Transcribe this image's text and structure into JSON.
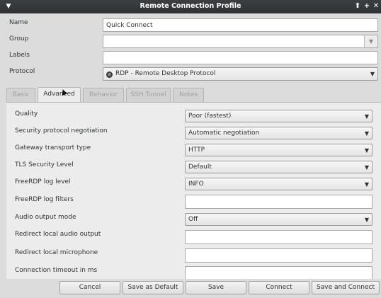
{
  "window": {
    "title": "Remote Connection Profile"
  },
  "titlebar_icons": [
    "menu-icon",
    "shade-up-icon",
    "maximize-icon",
    "close-icon"
  ],
  "form": {
    "name_label": "Name",
    "name_value": "Quick Connect",
    "group_label": "Group",
    "group_value": "",
    "labels_label": "Labels",
    "labels_value": "",
    "protocol_label": "Protocol",
    "protocol_value": "RDP - Remote Desktop Protocol"
  },
  "tabs": [
    {
      "label": "Basic",
      "active": false
    },
    {
      "label": "Advanced",
      "active": true
    },
    {
      "label": "Behavior",
      "active": false
    },
    {
      "label": "SSH Tunnel",
      "active": false
    },
    {
      "label": "Notes",
      "active": false
    }
  ],
  "advanced": {
    "quality_label": "Quality",
    "quality_value": "Poor (fastest)",
    "security_label": "Security protocol negotiation",
    "security_value": "Automatic negotiation",
    "gateway_label": "Gateway transport type",
    "gateway_value": "HTTP",
    "tls_label": "TLS Security Level",
    "tls_value": "Default",
    "loglevel_label": "FreeRDP log level",
    "loglevel_value": "INFO",
    "logfilters_label": "FreeRDP log filters",
    "logfilters_value": "",
    "audio_label": "Audio output mode",
    "audio_value": "Off",
    "redirect_audio_label": "Redirect local audio output",
    "redirect_audio_value": "",
    "redirect_mic_label": "Redirect local microphone",
    "redirect_mic_value": "",
    "timeout_label": "Connection timeout in ms",
    "timeout_value": ""
  },
  "footer": {
    "cancel": "Cancel",
    "save_default": "Save as Default",
    "save": "Save",
    "connect": "Connect",
    "save_connect": "Save and Connect"
  },
  "colors": {
    "titlebar": "#2f3235",
    "background": "#dcdcdc",
    "panel": "#ececec"
  }
}
